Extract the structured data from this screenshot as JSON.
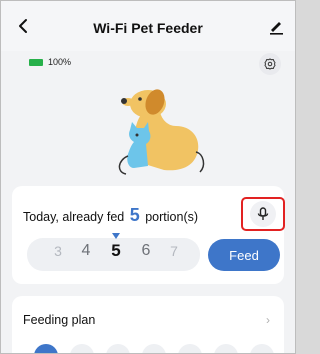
{
  "header": {
    "title": "Wi-Fi Pet Feeder"
  },
  "status": {
    "battery_percent": "100%",
    "battery_color": "#27b04a"
  },
  "feed": {
    "prefix": "Today, already fed",
    "count": "5",
    "suffix": "portion(s)",
    "picker_values": [
      "3",
      "4",
      "5",
      "6",
      "7"
    ],
    "selected": "5",
    "feed_button": "Feed"
  },
  "plan": {
    "title": "Feeding plan",
    "chevron": "›"
  },
  "colors": {
    "accent": "#3e76c9",
    "highlight": "#e22222"
  },
  "icons": [
    "back-arrow-icon",
    "edit-pencil-icon",
    "battery-icon",
    "settings-gear-icon",
    "pets-illustration",
    "microphone-icon",
    "chevron-right-icon"
  ]
}
